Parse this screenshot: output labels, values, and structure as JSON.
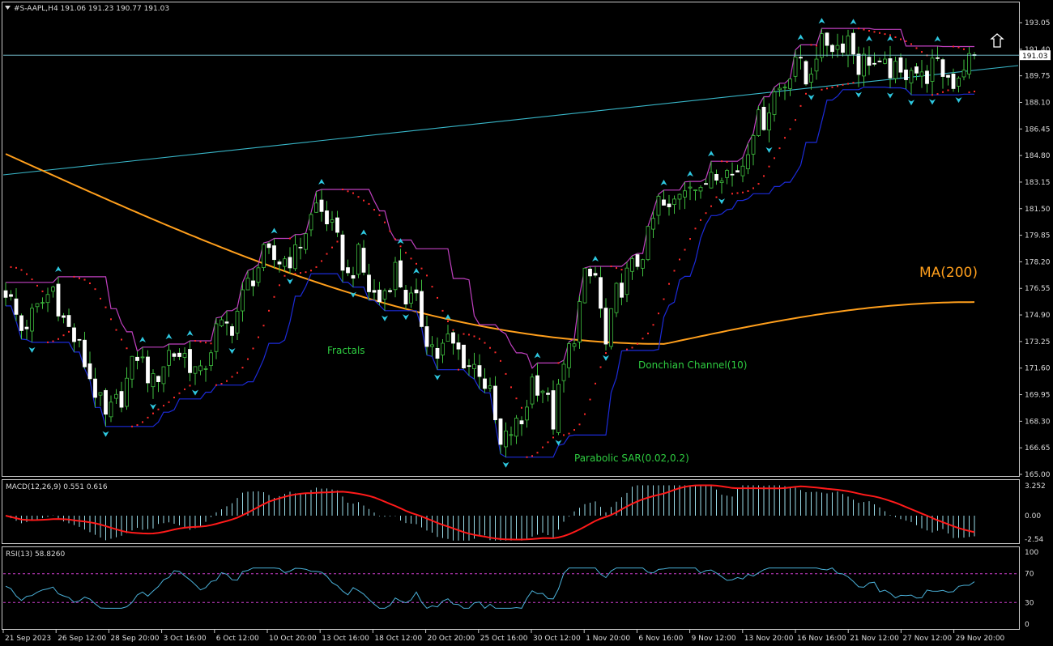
{
  "header": {
    "symbol_line": "#S-AAPL,H4  191.06 191.23 190.77 191.03"
  },
  "colors": {
    "background": "#000000",
    "frame": "#c8c8c8",
    "bull_candle": "#ffffff",
    "bear_candle": "#ffffff",
    "candle_wick": "#3fbf3f",
    "ma": "#ff9f1c",
    "trendline": "#38b6c8",
    "donchian_upper": "#c040c0",
    "donchian_lower": "#1c2bd9",
    "sar": "#ff2a2a",
    "fractal": "#2ec8e0",
    "label_green": "#2ecc40",
    "macd_hist": "#9adce8",
    "macd_signal": "#ff1a1a",
    "rsi_line": "#4ab0d8",
    "rsi_level": "#d33fd3",
    "current_price_line": "#7fd0e0"
  },
  "annotations": {
    "ma_label": "MA(200)",
    "fractals_label": "Fractals",
    "donchian_label": "Donchian Channel(10)",
    "sar_label": "Parabolic SAR(0.02,0.2)",
    "direction_icon": "up-arrow-icon"
  },
  "chart_data": [
    {
      "type": "candlestick",
      "title": "#S-AAPL,H4",
      "ohlc_last": {
        "open": 191.06,
        "high": 191.23,
        "low": 190.77,
        "close": 191.03
      },
      "current_price": 191.03,
      "ylim": [
        165.0,
        193.9
      ],
      "y_ticks": [
        193.05,
        191.4,
        189.75,
        188.1,
        186.45,
        184.8,
        183.15,
        181.5,
        179.85,
        178.2,
        176.55,
        174.9,
        173.25,
        171.6,
        169.95,
        168.3,
        166.65,
        165.0
      ],
      "x_tick_labels": [
        "21 Sep 2023",
        "26 Sep 12:00",
        "28 Sep 20:00",
        "3 Oct 16:00",
        "6 Oct 12:00",
        "10 Oct 20:00",
        "13 Oct 16:00",
        "18 Oct 12:00",
        "20 Oct 20:00",
        "25 Oct 16:00",
        "30 Oct 12:00",
        "1 Nov 20:00",
        "6 Nov 16:00",
        "9 Nov 12:00",
        "13 Nov 20:00",
        "16 Nov 16:00",
        "21 Nov 12:00",
        "27 Nov 12:00",
        "29 Nov 20:00"
      ],
      "close_path": [
        [
          0,
          176.5
        ],
        [
          3,
          174.0
        ],
        [
          6,
          175.2
        ],
        [
          9,
          176.6
        ],
        [
          11,
          174.6
        ],
        [
          14,
          172.8
        ],
        [
          17,
          170.2
        ],
        [
          19,
          168.4
        ],
        [
          22,
          169.9
        ],
        [
          25,
          172.5
        ],
        [
          28,
          170.6
        ],
        [
          31,
          172.6
        ],
        [
          34,
          172.4
        ],
        [
          37,
          171.0
        ],
        [
          40,
          173.9
        ],
        [
          43,
          174.3
        ],
        [
          46,
          176.8
        ],
        [
          49,
          178.5
        ],
        [
          52,
          178.3
        ],
        [
          55,
          178.6
        ],
        [
          57,
          180.2
        ],
        [
          59,
          181.7
        ],
        [
          61,
          180.9
        ],
        [
          63,
          179.3
        ],
        [
          65,
          177.2
        ],
        [
          67,
          178.5
        ],
        [
          69,
          176.5
        ],
        [
          71,
          175.8
        ],
        [
          74,
          177.8
        ],
        [
          76,
          176.0
        ],
        [
          78,
          175.5
        ],
        [
          80,
          173.6
        ],
        [
          82,
          172.4
        ],
        [
          84,
          173.3
        ],
        [
          86,
          172.6
        ],
        [
          88,
          171.8
        ],
        [
          90,
          171.6
        ],
        [
          92,
          169.8
        ],
        [
          94,
          166.6
        ],
        [
          96,
          167.7
        ],
        [
          98,
          168.2
        ],
        [
          100,
          170.9
        ],
        [
          102,
          170.4
        ],
        [
          104,
          168.3
        ],
        [
          106,
          171.6
        ],
        [
          108,
          173.8
        ],
        [
          110,
          177.1
        ],
        [
          112,
          177.3
        ],
        [
          114,
          172.9
        ],
        [
          116,
          176.2
        ],
        [
          118,
          177.3
        ],
        [
          120,
          178.2
        ],
        [
          122,
          179.6
        ],
        [
          124,
          181.9
        ],
        [
          126,
          181.2
        ],
        [
          128,
          182.7
        ],
        [
          130,
          183.5
        ],
        [
          132,
          182.2
        ],
        [
          134,
          184.1
        ],
        [
          136,
          184.0
        ],
        [
          138,
          183.6
        ],
        [
          140,
          184.4
        ],
        [
          142,
          186.7
        ],
        [
          144,
          187.1
        ],
        [
          146,
          188.7
        ],
        [
          148,
          189.3
        ],
        [
          150,
          191.1
        ],
        [
          152,
          189.3
        ],
        [
          154,
          191.3
        ],
        [
          156,
          191.9
        ],
        [
          158,
          191.6
        ],
        [
          160,
          192.2
        ],
        [
          162,
          190.4
        ],
        [
          164,
          190.9
        ],
        [
          166,
          190.0
        ],
        [
          168,
          190.2
        ],
        [
          170,
          189.6
        ],
        [
          172,
          190.6
        ],
        [
          174,
          189.5
        ],
        [
          176,
          190.3
        ],
        [
          178,
          190.0
        ],
        [
          180,
          189.4
        ],
        [
          182,
          190.5
        ],
        [
          184,
          191.0
        ]
      ]
    },
    {
      "type": "line",
      "title": "MACD(12,26,9) 0.551 0.616",
      "macd": 0.551,
      "signal": 0.616,
      "ylim": [
        -3.2,
        4.0
      ],
      "y_ticks": [
        3.252,
        0.0,
        -2.54
      ]
    },
    {
      "type": "line",
      "title": "RSI(13) 58.8260",
      "rsi": 58.826,
      "ylim": [
        0,
        100
      ],
      "y_ticks": [
        100,
        70,
        30,
        0
      ],
      "levels": [
        70,
        30
      ]
    }
  ]
}
